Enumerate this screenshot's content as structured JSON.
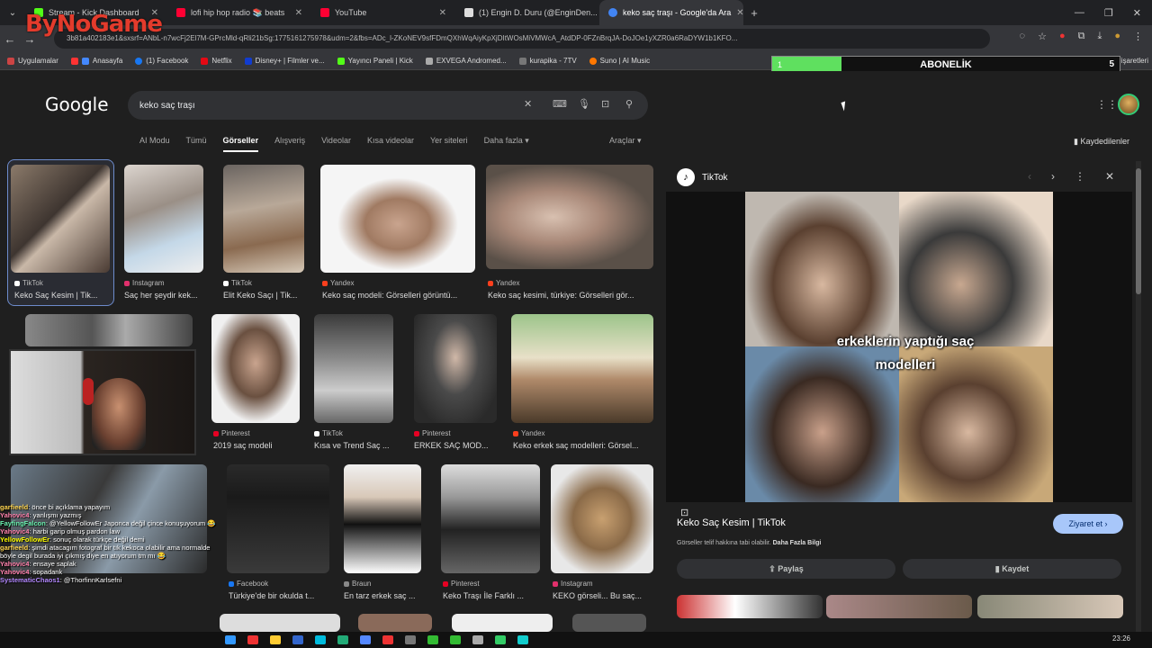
{
  "tabs": [
    {
      "title": "Stream - Kick Dashboard",
      "color": "#53fc18"
    },
    {
      "title": "lofi hip hop radio 📚 beats",
      "color": "#ff0033"
    },
    {
      "title": "YouTube",
      "color": "#ff0033"
    },
    {
      "title": "(1) Engin D. Duru (@EnginDen...",
      "color": "#dddddd"
    },
    {
      "title": "keko saç traşı - Google'da Ara",
      "color": "#4285f4"
    }
  ],
  "url": "3b81a402183e1&sxsrf=ANbL-n7wcFj2El7M-GPrcMld-qRli21bSg:1775161275978&udm=2&fbs=ADc_l-ZKoNEV9sfFDmQXhWqAiyKpXjDItWOsMiVMWcA_AtdDP-0FZnBrqJA-DoJOe1yXZR0a6RaDYW1b1KFO...",
  "overlay_logo": "ByNoGame",
  "bookmarks": [
    "Uygulamalar",
    "Anasayfa",
    "(1) Facebook",
    "Netflix",
    "Disney+ | Filmler ve...",
    "Yayıncı Paneli | Kick",
    "EXVEGA Andromed...",
    "kurapika - 7TV",
    "Suno | AI Music"
  ],
  "bookmarks_right": "Tüm yer işaretleri",
  "subscription": {
    "label": "ABONELİK",
    "current": "1",
    "goal": "5",
    "progress": 0.2
  },
  "google_logo": "Google",
  "search_query": "keko saç traşı",
  "filters": [
    "AI Modu",
    "Tümü",
    "Görseller",
    "Alışveriş",
    "Videolar",
    "Kısa videolar",
    "Yer siteleri",
    "Daha fazla ▾"
  ],
  "filter_selected": "Görseller",
  "tools_label": "Araçlar ▾",
  "saved_label": "Kaydedilenler",
  "results": [
    {
      "source": "TikTok",
      "title": "Keko Saç Kesim | Tik...",
      "srccolor": "#ffffff"
    },
    {
      "source": "Instagram",
      "title": "Saç her şeydir kek...",
      "srccolor": "#e1306c"
    },
    {
      "source": "TikTok",
      "title": "Elit Keko Saçı | Tik...",
      "srccolor": "#ffffff"
    },
    {
      "source": "Yandex",
      "title": "Keko saç modeli: Görselleri görüntü...",
      "srccolor": "#fc3f1d"
    },
    {
      "source": "Yandex",
      "title": "Keko saç kesimi, türkiye: Görselleri gör...",
      "srccolor": "#fc3f1d"
    },
    {
      "source": "Pinterest",
      "title": "2019 saç modeli",
      "srccolor": "#e60023"
    },
    {
      "source": "TikTok",
      "title": "Kısa ve Trend Saç ...",
      "srccolor": "#ffffff"
    },
    {
      "source": "Pinterest",
      "title": "ERKEK SAÇ MOD...",
      "srccolor": "#e60023"
    },
    {
      "source": "Yandex",
      "title": "Keko erkek saç modelleri: Görsel...",
      "srccolor": "#fc3f1d"
    },
    {
      "source": "Facebook",
      "title": "Türkiye'de bir okulda t...",
      "srccolor": "#1877f2"
    },
    {
      "source": "Braun",
      "title": "En tarz erkek saç ...",
      "srccolor": "#888888"
    },
    {
      "source": "Pinterest",
      "title": "Keko Traşı İle Farklı ...",
      "srccolor": "#e60023"
    },
    {
      "source": "Instagram",
      "title": "KEKO görseli... Bu saç...",
      "srccolor": "#e1306c"
    }
  ],
  "panel": {
    "source": "TikTok",
    "caption_line1": "erkeklerin yaptığı saç",
    "caption_line2": "modelleri",
    "title": "Keko Saç Kesim | TikTok",
    "visit_label": "Ziyaret et ›",
    "copyright": "Görseller telif hakkına tabi olabilir.",
    "copyright_link": "Daha Fazla Bilgi",
    "share_label": "Paylaş",
    "save_label": "Kaydet"
  },
  "chat": [
    {
      "user": "garfieeld",
      "msg": ": önce bi açıklama yapayım",
      "color": "#ffd54f"
    },
    {
      "user": "Yahovic4",
      "msg": ": yanlışmı yazmış",
      "color": "#ff80ab"
    },
    {
      "user": "FayfingFalcon",
      "msg": ": @YellowFollowEr Japonca değil çince konuşuyorum 😂",
      "color": "#69f0ae"
    },
    {
      "user": "Yahovic4",
      "msg": ": harbi garip olmuş pardon law",
      "color": "#ff80ab"
    },
    {
      "user": "YellowFollowEr",
      "msg": ": sonuç olarak türkçe değil demi",
      "color": "#ffff00"
    },
    {
      "user": "garfieeld",
      "msg": ": şimdi atacagım fotograf bir tık kekoca olabilir ama normalde böyle degil burada iyi çıkmış diye en atıyorum tm mı 😂",
      "color": "#ffd54f"
    },
    {
      "user": "Yahovic4",
      "msg": ": ensaye saplak",
      "color": "#ff80ab"
    },
    {
      "user": "Yahovic4",
      "msg": ": sopadank",
      "color": "#ff80ab"
    },
    {
      "user": "SystematicChaos1",
      "msg": ": @ThorfinnKarlsefni",
      "color": "#b388ff"
    }
  ],
  "clock": "23:26"
}
